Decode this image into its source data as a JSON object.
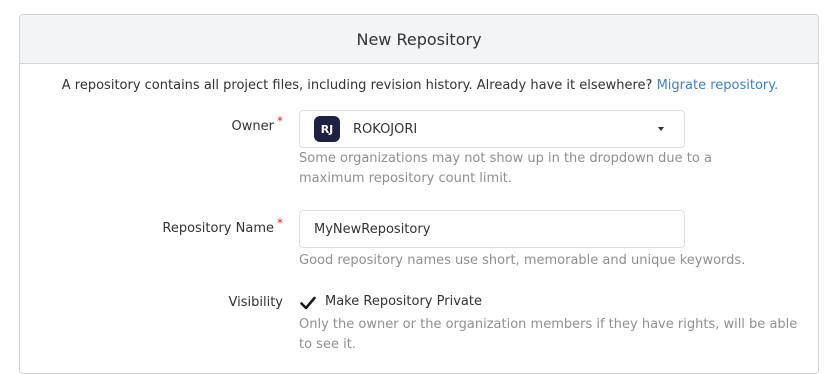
{
  "header": {
    "title": "New Repository"
  },
  "intro": {
    "text": "A repository contains all project files, including revision history. Already have it elsewhere? ",
    "link": "Migrate repository."
  },
  "form": {
    "owner": {
      "label": "Owner",
      "required_mark": "*",
      "avatar_initials": "RJ",
      "value": "ROKOJORI",
      "help": "Some organizations may not show up in the dropdown due to a maximum repository count limit."
    },
    "repo_name": {
      "label": "Repository Name",
      "required_mark": "*",
      "value": "MyNewRepository",
      "help": "Good repository names use short, memorable and unique keywords."
    },
    "visibility": {
      "label": "Visibility",
      "checkbox_label": "Make Repository Private",
      "checked": true,
      "help": "Only the owner or the organization members if they have rights, will be able to see it."
    }
  },
  "colors": {
    "link": "#4183c4",
    "required": "#db2828",
    "help_text": "#909090",
    "avatar_bg": "#1e2240"
  },
  "icons": {
    "dropdown": "caret-down-icon",
    "checkbox": "checkmark-icon"
  }
}
